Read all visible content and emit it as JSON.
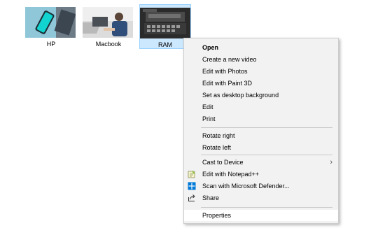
{
  "files": [
    {
      "name": "HP",
      "thumbnail": "hp-photo",
      "selected": false
    },
    {
      "name": "Macbook",
      "thumbnail": "macbook-photo",
      "selected": false
    },
    {
      "name": "RAM",
      "thumbnail": "ram-photo",
      "selected": true
    }
  ],
  "context_menu": {
    "open": "Open",
    "create_video": "Create a new video",
    "edit_photos": "Edit with Photos",
    "edit_paint3d": "Edit with Paint 3D",
    "set_background": "Set as desktop background",
    "edit": "Edit",
    "print": "Print",
    "rotate_right": "Rotate right",
    "rotate_left": "Rotate left",
    "cast_to_device": "Cast to Device",
    "edit_notepadpp": "Edit with Notepad++",
    "scan_defender": "Scan with Microsoft Defender...",
    "share": "Share",
    "properties": "Properties"
  },
  "icons": {
    "cast_submenu": "chevron-right-icon",
    "notepadpp": "notepadpp-icon",
    "defender": "defender-icon",
    "share": "share-icon"
  },
  "colors": {
    "selection_bg": "#cce8ff",
    "selection_border": "#99d1ff",
    "menu_bg": "#f2f2f2",
    "defender_blue": "#0078d7"
  }
}
